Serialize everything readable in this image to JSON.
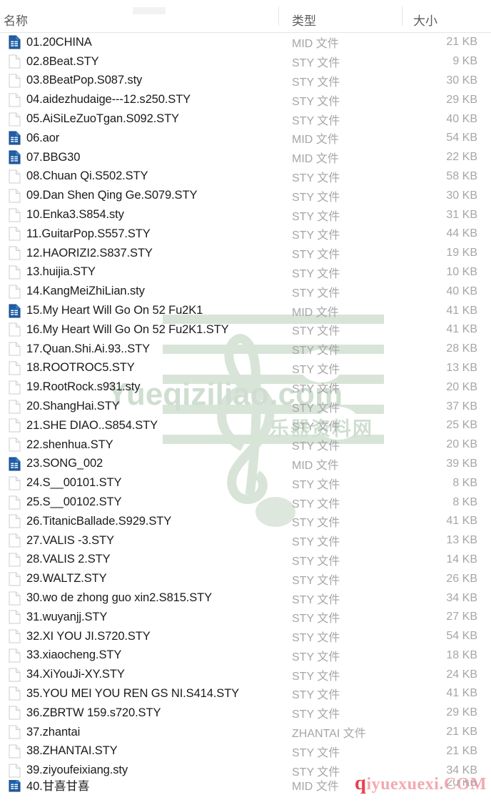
{
  "window": {
    "app": "File Explorer",
    "view_mode": "Details"
  },
  "columns": {
    "name": "名称",
    "type": "类型",
    "size": "大小"
  },
  "watermark": {
    "main_text": "Yueqiziliao.com",
    "cn_text": "乐器资料网",
    "bottom_prefix": "q",
    "bottom_text": "iyuexuexi.COM",
    "green": "#cfded0",
    "red": "#e8414f"
  },
  "files": [
    {
      "name": "01.20CHINA",
      "type": "MID 文件",
      "size": "21 KB",
      "icon": "mid-file-icon"
    },
    {
      "name": "02.8Beat.STY",
      "type": "STY 文件",
      "size": "9 KB",
      "icon": "blank-file-icon"
    },
    {
      "name": "03.8BeatPop.S087.sty",
      "type": "STY 文件",
      "size": "30 KB",
      "icon": "blank-file-icon"
    },
    {
      "name": "04.aidezhudaige---12.s250.STY",
      "type": "STY 文件",
      "size": "29 KB",
      "icon": "blank-file-icon"
    },
    {
      "name": "05.AiSiLeZuoTgan.S092.STY",
      "type": "STY 文件",
      "size": "40 KB",
      "icon": "blank-file-icon"
    },
    {
      "name": "06.aor",
      "type": "MID 文件",
      "size": "54 KB",
      "icon": "mid-file-icon"
    },
    {
      "name": "07.BBG30",
      "type": "MID 文件",
      "size": "22 KB",
      "icon": "mid-file-icon"
    },
    {
      "name": "08.Chuan Qi.S502.STY",
      "type": "STY 文件",
      "size": "58 KB",
      "icon": "blank-file-icon"
    },
    {
      "name": "09.Dan Shen Qing Ge.S079.STY",
      "type": "STY 文件",
      "size": "30 KB",
      "icon": "blank-file-icon"
    },
    {
      "name": "10.Enka3.S854.sty",
      "type": "STY 文件",
      "size": "31 KB",
      "icon": "blank-file-icon"
    },
    {
      "name": "11.GuitarPop.S557.STY",
      "type": "STY 文件",
      "size": "44 KB",
      "icon": "blank-file-icon"
    },
    {
      "name": "12.HAORIZI2.S837.STY",
      "type": "STY 文件",
      "size": "19 KB",
      "icon": "blank-file-icon"
    },
    {
      "name": "13.huijia.STY",
      "type": "STY 文件",
      "size": "10 KB",
      "icon": "blank-file-icon"
    },
    {
      "name": "14.KangMeiZhiLian.sty",
      "type": "STY 文件",
      "size": "40 KB",
      "icon": "blank-file-icon"
    },
    {
      "name": "15.My Heart Will Go On 52 Fu2K1",
      "type": "MID 文件",
      "size": "41 KB",
      "icon": "mid-file-icon"
    },
    {
      "name": "16.My Heart Will Go On 52 Fu2K1.STY",
      "type": "STY 文件",
      "size": "41 KB",
      "icon": "blank-file-icon"
    },
    {
      "name": "17.Quan.Shi.Ai.93..STY",
      "type": "STY 文件",
      "size": "28 KB",
      "icon": "blank-file-icon"
    },
    {
      "name": "18.ROOTROC5.STY",
      "type": "STY 文件",
      "size": "13 KB",
      "icon": "blank-file-icon"
    },
    {
      "name": "19.RootRock.s931.sty",
      "type": "STY 文件",
      "size": "20 KB",
      "icon": "blank-file-icon"
    },
    {
      "name": "20.ShangHai.STY",
      "type": "STY 文件",
      "size": "37 KB",
      "icon": "blank-file-icon"
    },
    {
      "name": "21.SHE DIAO..S854.STY",
      "type": "STY 文件",
      "size": "25 KB",
      "icon": "blank-file-icon"
    },
    {
      "name": "22.shenhua.STY",
      "type": "STY 文件",
      "size": "20 KB",
      "icon": "blank-file-icon"
    },
    {
      "name": "23.SONG_002",
      "type": "MID 文件",
      "size": "39 KB",
      "icon": "mid-file-icon"
    },
    {
      "name": "24.S__00101.STY",
      "type": "STY 文件",
      "size": "8 KB",
      "icon": "blank-file-icon"
    },
    {
      "name": "25.S__00102.STY",
      "type": "STY 文件",
      "size": "8 KB",
      "icon": "blank-file-icon"
    },
    {
      "name": "26.TitanicBallade.S929.STY",
      "type": "STY 文件",
      "size": "41 KB",
      "icon": "blank-file-icon"
    },
    {
      "name": "27.VALIS -3.STY",
      "type": "STY 文件",
      "size": "13 KB",
      "icon": "blank-file-icon"
    },
    {
      "name": "28.VALIS 2.STY",
      "type": "STY 文件",
      "size": "14 KB",
      "icon": "blank-file-icon"
    },
    {
      "name": "29.WALTZ.STY",
      "type": "STY 文件",
      "size": "26 KB",
      "icon": "blank-file-icon"
    },
    {
      "name": "30.wo de zhong guo xin2.S815.STY",
      "type": "STY 文件",
      "size": "34 KB",
      "icon": "blank-file-icon"
    },
    {
      "name": "31.wuyanjj.STY",
      "type": "STY 文件",
      "size": "27 KB",
      "icon": "blank-file-icon"
    },
    {
      "name": "32.XI YOU JI.S720.STY",
      "type": "STY 文件",
      "size": "54 KB",
      "icon": "blank-file-icon"
    },
    {
      "name": "33.xiaocheng.STY",
      "type": "STY 文件",
      "size": "18 KB",
      "icon": "blank-file-icon"
    },
    {
      "name": "34.XiYouJi-XY.STY",
      "type": "STY 文件",
      "size": "24 KB",
      "icon": "blank-file-icon"
    },
    {
      "name": "35.YOU MEI YOU REN GS NI.S414.STY",
      "type": "STY 文件",
      "size": "41 KB",
      "icon": "blank-file-icon"
    },
    {
      "name": "36.ZBRTW 159.s720.STY",
      "type": "STY 文件",
      "size": "29 KB",
      "icon": "blank-file-icon"
    },
    {
      "name": "37.zhantai",
      "type": "ZHANTAI 文件",
      "size": "21 KB",
      "icon": "blank-file-icon"
    },
    {
      "name": "38.ZHANTAI.STY",
      "type": "STY 文件",
      "size": "21 KB",
      "icon": "blank-file-icon"
    },
    {
      "name": "39.ziyoufeixiang.sty",
      "type": "STY 文件",
      "size": "34 KB",
      "icon": "blank-file-icon"
    },
    {
      "name": "40.甘喜甘喜",
      "type": "MID 文件",
      "size": "20 KB",
      "icon": "mid-file-icon"
    }
  ]
}
